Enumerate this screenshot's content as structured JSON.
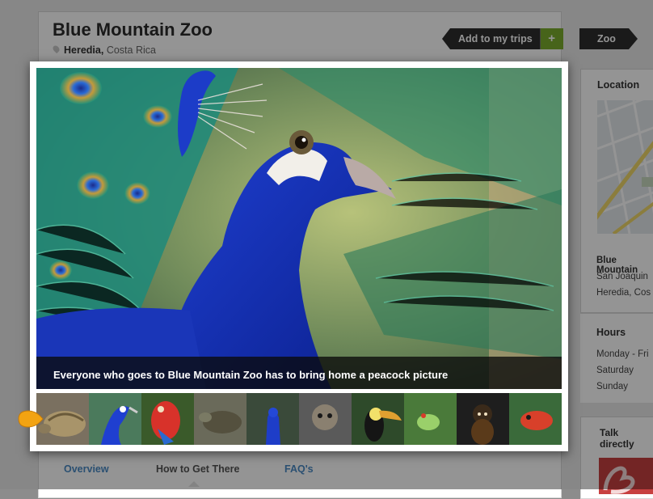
{
  "venue": {
    "name": "Blue Mountain Zoo",
    "city": "Heredia,",
    "country": "Costa Rica"
  },
  "actions": {
    "add_to_trips": "Add to my trips",
    "add_icon": "+"
  },
  "category_tag": "Zoo",
  "tabs": [
    "Overview",
    "How to Get There",
    "FAQ's"
  ],
  "sidebar": {
    "location_heading": "Location",
    "address_name": "Blue Mountain",
    "address_line1": "San Joaquin",
    "address_line2": "Heredia, Cos",
    "hours_heading": "Hours",
    "hours": [
      "Monday - Fri",
      "Saturday",
      "Sunday"
    ],
    "talk_heading": "Talk directly"
  },
  "gallery": {
    "caption": "Everyone who goes to Blue Mountain Zoo has to bring home a peacock picture",
    "active_index": 1,
    "thumbnails": [
      "tortoise",
      "peacock",
      "macaw",
      "turtle",
      "peacock-front",
      "marmoset",
      "toucan",
      "tree-frog",
      "monkey",
      "poison-frog"
    ]
  },
  "colors": {
    "accent_green": "#7aac2e",
    "link_blue": "#4a8bc5",
    "active_thumb": "#3aa0ff",
    "nav_arrow": "#f2a312"
  }
}
